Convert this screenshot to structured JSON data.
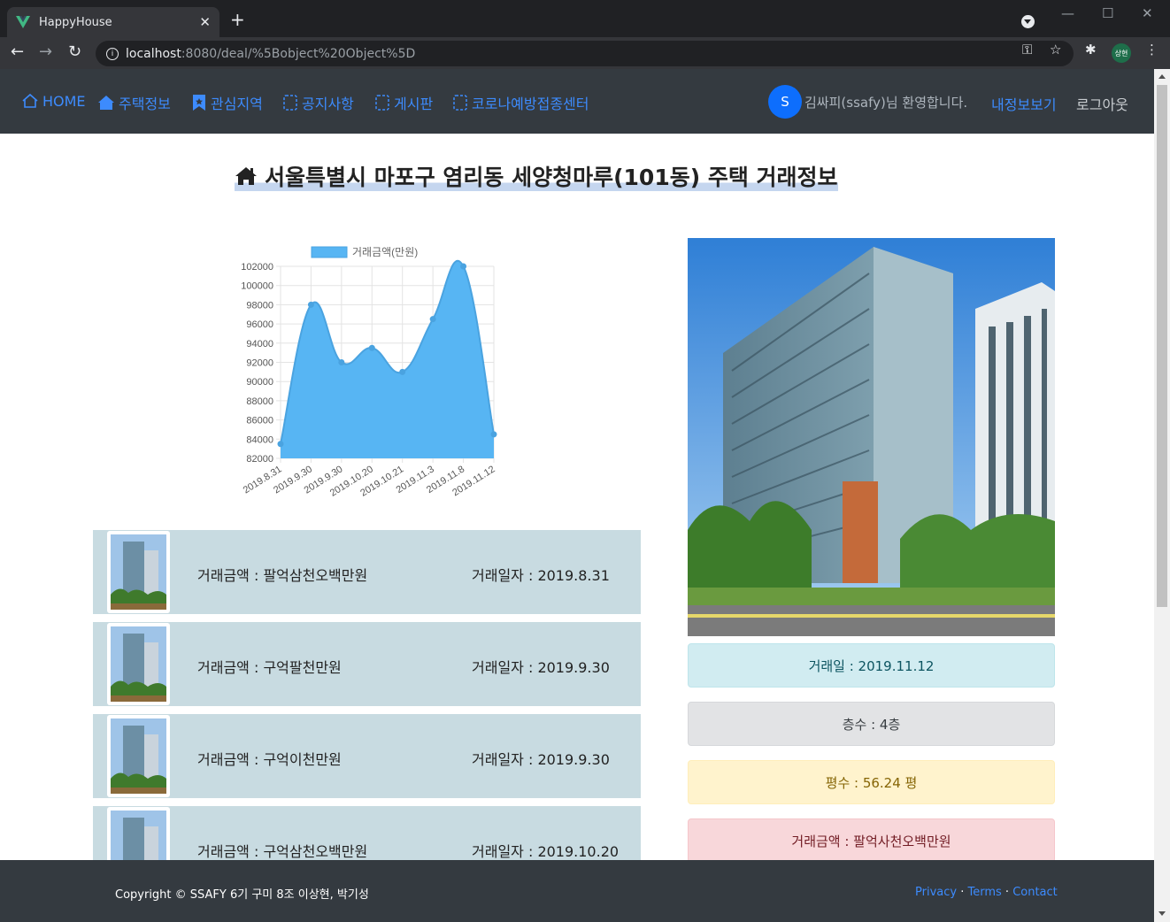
{
  "browser": {
    "tab_title": "HappyHouse",
    "tab_close": "✕",
    "new_tab": "+",
    "url_host": "localhost",
    "url_path": ":8080/deal/%5Bobject%20Object%5D",
    "profile_label": "상현"
  },
  "nav": {
    "home": "HOME",
    "house_info": "주택정보",
    "interest_area": "관심지역",
    "notice": "공지사항",
    "board": "게시판",
    "covid_center": "코로나예방접종센터",
    "avatar_letter": "S",
    "welcome": "김싸피(ssafy)님 환영합니다.",
    "my_info": "내정보보기",
    "logout": "로그아웃"
  },
  "page": {
    "title": "서울특별시 마포구 염리동 세양청마루(101동) 주택 거래정보"
  },
  "chart_data": {
    "type": "area",
    "legend": "거래금액(만원)",
    "x": [
      "2019.8.31",
      "2019.9.30",
      "2019.9.30",
      "2019.10.20",
      "2019.10.21",
      "2019.11.3",
      "2019.11.8",
      "2019.11.12"
    ],
    "series": [
      {
        "name": "거래금액(만원)",
        "values": [
          83500,
          98000,
          92000,
          93500,
          91000,
          96500,
          102000,
          84500
        ]
      }
    ],
    "ylim": [
      82000,
      102000
    ],
    "y_ticks": [
      "102000",
      "100000",
      "98000",
      "96000",
      "94000",
      "92000",
      "90000",
      "88000",
      "86000",
      "84000",
      "82000"
    ],
    "grid": true,
    "legend_position": "top",
    "color": "#57b5f3"
  },
  "deals": [
    {
      "price": "거래금액 : 팔억삼천오백만원",
      "date": "거래일자 : 2019.8.31"
    },
    {
      "price": "거래금액 : 구억팔천만원",
      "date": "거래일자 : 2019.9.30"
    },
    {
      "price": "거래금액 : 구억이천만원",
      "date": "거래일자 : 2019.9.30"
    },
    {
      "price": "거래금액 : 구억삼천오백만원",
      "date": "거래일자 : 2019.10.20"
    }
  ],
  "details": {
    "deal_date": "거래일 : 2019.11.12",
    "floor": "층수 : 4층",
    "area": "평수 : 56.24 평",
    "price": "거래금액 : 팔억사천오백만원"
  },
  "footer": {
    "copyright": "Copyright © SSAFY 6기 구미 8조 이상현, 박기성",
    "privacy": "Privacy",
    "terms": "Terms",
    "contact": "Contact",
    "separator": " · "
  }
}
